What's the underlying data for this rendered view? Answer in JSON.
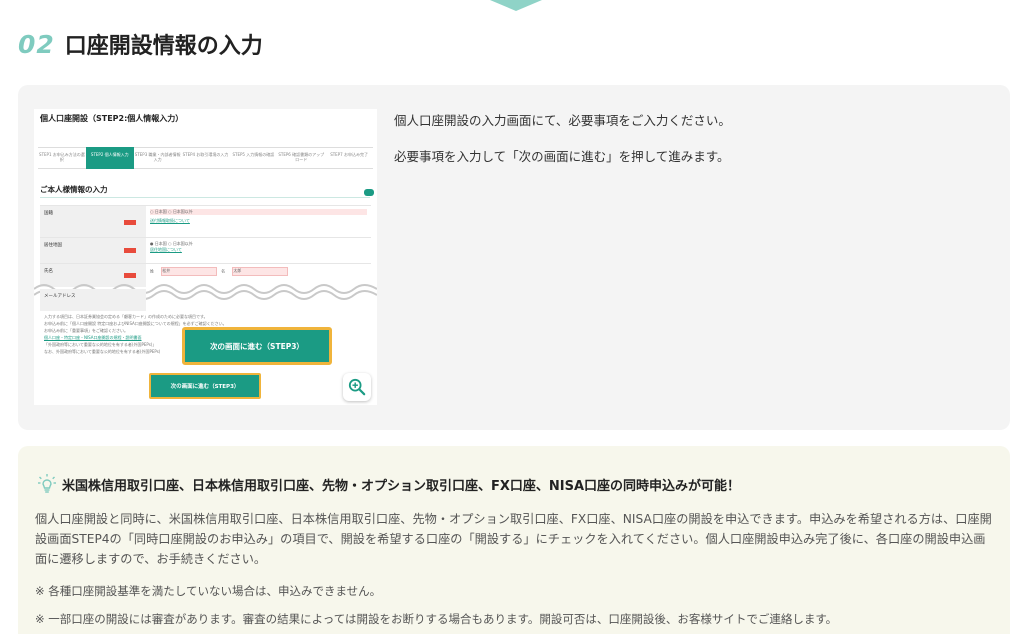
{
  "heading": {
    "number": "02",
    "title": "口座開設情報の入力"
  },
  "screenshot": {
    "title": "個人口座開設（STEP2:個人情報入力）",
    "steps": [
      {
        "label": "STEP1 お申込み方法の選択"
      },
      {
        "label": "STEP2 個人情報入力"
      },
      {
        "label": "STEP3 職業・内部者情報入力"
      },
      {
        "label": "STEP4 お取引環境の入力"
      },
      {
        "label": "STEP5 入力情報の確認"
      },
      {
        "label": "STEP6 確認書類のアップロード"
      },
      {
        "label": "STEP7 お申込み完了"
      }
    ],
    "section_title": "ご本人様情報の入力",
    "rows": [
      {
        "label": "国籍",
        "opt1": "日本国",
        "opt2": "日本国以外",
        "link": "送付情報取扱について"
      },
      {
        "label": "居住地国",
        "opt1": "日本国",
        "opt2": "日本国以外",
        "link": "居住地国について"
      },
      {
        "label": "氏名",
        "first": "姓",
        "last": "名",
        "ph1": "松井",
        "ph2": "太郎"
      },
      {
        "label": "メールアドレス"
      }
    ],
    "notes": [
      "入力する項目は、日本証券業協会の定める「顧客カード」の作成のために必要な項目です。",
      "お申込み前に「個人口座開設 特定口座およびNISA口座開設についての規程」を必ずご確認ください。",
      "お申込み前に「重要事項」をご確認ください。",
      "個人口座・特定口座・NISA口座開設の規程・説明書面",
      "「外国政府等において重要な公的地位を有する者(外国PEPs)」",
      "なお、外国政府等において重要な公的地位を有する者(外国PEPs)"
    ],
    "next_button_large": "次の画面に進む（STEP3）",
    "next_button_small": "次の画面に進む（STEP3）"
  },
  "description": [
    "個人口座開設の入力画面にて、必要事項をご入力ください。",
    "必要事項を入力して「次の画面に進む」を押して進みます。"
  ],
  "info": {
    "title": "米国株信用取引口座、日本株信用取引口座、先物・オプション取引口座、FX口座、NISA口座の同時申込みが可能！",
    "body": "個人口座開設と同時に、米国株信用取引口座、日本株信用取引口座、先物・オプション取引口座、FX口座、NISA口座の開設を申込できます。申込みを希望される方は、口座開設画面STEP4の「同時口座開設のお申込み」の項目で、開設を希望する口座の「開設する」にチェックを入れてください。個人口座開設申込み完了後に、各口座の開設申込画面に遷移しますので、お手続きください。",
    "note1": "※ 各種口座開設基準を満たしていない場合は、申込みできません。",
    "note2": "※ 一部口座の開設には審査があります。審査の結果によっては開設をお断りする場合もあります。開設可否は、口座開設後、お客様サイトでご連絡します。"
  },
  "colors": {
    "accent": "#7fcbbf",
    "button": "#1b9b84",
    "highlight": "#f0b43b",
    "required": "#e84b3c"
  },
  "icons": {
    "zoom": "zoom-in-icon",
    "bulb": "lightbulb-icon"
  }
}
